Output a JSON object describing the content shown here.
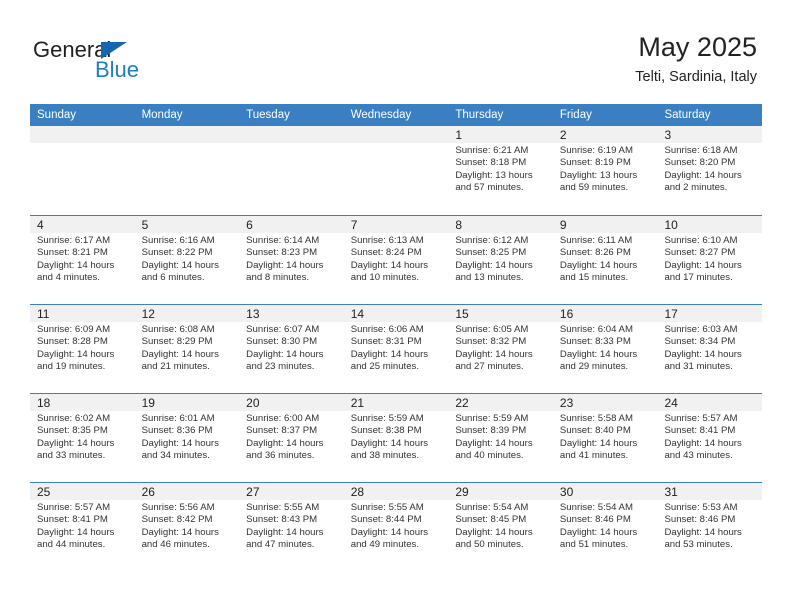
{
  "brand": {
    "name_primary": "General",
    "name_secondary": "Blue",
    "triangle_icon": "triangle-icon"
  },
  "header": {
    "title": "May 2025",
    "subtitle": "Telti, Sardinia, Italy"
  },
  "colors": {
    "header_blue": "#3a7fc1",
    "brand_blue": "#1f7dc4",
    "triangle_blue": "#1565b0",
    "daynum_bar": "#f1f1f1",
    "text": "#222222"
  },
  "weekdays": [
    "Sunday",
    "Monday",
    "Tuesday",
    "Wednesday",
    "Thursday",
    "Friday",
    "Saturday"
  ],
  "weeks": [
    [
      {
        "day": "",
        "empty": true
      },
      {
        "day": "",
        "empty": true
      },
      {
        "day": "",
        "empty": true
      },
      {
        "day": "",
        "empty": true
      },
      {
        "day": "1",
        "sunrise": "Sunrise: 6:21 AM",
        "sunset": "Sunset: 8:18 PM",
        "daylight": "Daylight: 13 hours and 57 minutes."
      },
      {
        "day": "2",
        "sunrise": "Sunrise: 6:19 AM",
        "sunset": "Sunset: 8:19 PM",
        "daylight": "Daylight: 13 hours and 59 minutes."
      },
      {
        "day": "3",
        "sunrise": "Sunrise: 6:18 AM",
        "sunset": "Sunset: 8:20 PM",
        "daylight": "Daylight: 14 hours and 2 minutes."
      }
    ],
    [
      {
        "day": "4",
        "sunrise": "Sunrise: 6:17 AM",
        "sunset": "Sunset: 8:21 PM",
        "daylight": "Daylight: 14 hours and 4 minutes."
      },
      {
        "day": "5",
        "sunrise": "Sunrise: 6:16 AM",
        "sunset": "Sunset: 8:22 PM",
        "daylight": "Daylight: 14 hours and 6 minutes."
      },
      {
        "day": "6",
        "sunrise": "Sunrise: 6:14 AM",
        "sunset": "Sunset: 8:23 PM",
        "daylight": "Daylight: 14 hours and 8 minutes."
      },
      {
        "day": "7",
        "sunrise": "Sunrise: 6:13 AM",
        "sunset": "Sunset: 8:24 PM",
        "daylight": "Daylight: 14 hours and 10 minutes."
      },
      {
        "day": "8",
        "sunrise": "Sunrise: 6:12 AM",
        "sunset": "Sunset: 8:25 PM",
        "daylight": "Daylight: 14 hours and 13 minutes."
      },
      {
        "day": "9",
        "sunrise": "Sunrise: 6:11 AM",
        "sunset": "Sunset: 8:26 PM",
        "daylight": "Daylight: 14 hours and 15 minutes."
      },
      {
        "day": "10",
        "sunrise": "Sunrise: 6:10 AM",
        "sunset": "Sunset: 8:27 PM",
        "daylight": "Daylight: 14 hours and 17 minutes."
      }
    ],
    [
      {
        "day": "11",
        "sunrise": "Sunrise: 6:09 AM",
        "sunset": "Sunset: 8:28 PM",
        "daylight": "Daylight: 14 hours and 19 minutes."
      },
      {
        "day": "12",
        "sunrise": "Sunrise: 6:08 AM",
        "sunset": "Sunset: 8:29 PM",
        "daylight": "Daylight: 14 hours and 21 minutes."
      },
      {
        "day": "13",
        "sunrise": "Sunrise: 6:07 AM",
        "sunset": "Sunset: 8:30 PM",
        "daylight": "Daylight: 14 hours and 23 minutes."
      },
      {
        "day": "14",
        "sunrise": "Sunrise: 6:06 AM",
        "sunset": "Sunset: 8:31 PM",
        "daylight": "Daylight: 14 hours and 25 minutes."
      },
      {
        "day": "15",
        "sunrise": "Sunrise: 6:05 AM",
        "sunset": "Sunset: 8:32 PM",
        "daylight": "Daylight: 14 hours and 27 minutes."
      },
      {
        "day": "16",
        "sunrise": "Sunrise: 6:04 AM",
        "sunset": "Sunset: 8:33 PM",
        "daylight": "Daylight: 14 hours and 29 minutes."
      },
      {
        "day": "17",
        "sunrise": "Sunrise: 6:03 AM",
        "sunset": "Sunset: 8:34 PM",
        "daylight": "Daylight: 14 hours and 31 minutes."
      }
    ],
    [
      {
        "day": "18",
        "sunrise": "Sunrise: 6:02 AM",
        "sunset": "Sunset: 8:35 PM",
        "daylight": "Daylight: 14 hours and 33 minutes."
      },
      {
        "day": "19",
        "sunrise": "Sunrise: 6:01 AM",
        "sunset": "Sunset: 8:36 PM",
        "daylight": "Daylight: 14 hours and 34 minutes."
      },
      {
        "day": "20",
        "sunrise": "Sunrise: 6:00 AM",
        "sunset": "Sunset: 8:37 PM",
        "daylight": "Daylight: 14 hours and 36 minutes."
      },
      {
        "day": "21",
        "sunrise": "Sunrise: 5:59 AM",
        "sunset": "Sunset: 8:38 PM",
        "daylight": "Daylight: 14 hours and 38 minutes."
      },
      {
        "day": "22",
        "sunrise": "Sunrise: 5:59 AM",
        "sunset": "Sunset: 8:39 PM",
        "daylight": "Daylight: 14 hours and 40 minutes."
      },
      {
        "day": "23",
        "sunrise": "Sunrise: 5:58 AM",
        "sunset": "Sunset: 8:40 PM",
        "daylight": "Daylight: 14 hours and 41 minutes."
      },
      {
        "day": "24",
        "sunrise": "Sunrise: 5:57 AM",
        "sunset": "Sunset: 8:41 PM",
        "daylight": "Daylight: 14 hours and 43 minutes."
      }
    ],
    [
      {
        "day": "25",
        "sunrise": "Sunrise: 5:57 AM",
        "sunset": "Sunset: 8:41 PM",
        "daylight": "Daylight: 14 hours and 44 minutes."
      },
      {
        "day": "26",
        "sunrise": "Sunrise: 5:56 AM",
        "sunset": "Sunset: 8:42 PM",
        "daylight": "Daylight: 14 hours and 46 minutes."
      },
      {
        "day": "27",
        "sunrise": "Sunrise: 5:55 AM",
        "sunset": "Sunset: 8:43 PM",
        "daylight": "Daylight: 14 hours and 47 minutes."
      },
      {
        "day": "28",
        "sunrise": "Sunrise: 5:55 AM",
        "sunset": "Sunset: 8:44 PM",
        "daylight": "Daylight: 14 hours and 49 minutes."
      },
      {
        "day": "29",
        "sunrise": "Sunrise: 5:54 AM",
        "sunset": "Sunset: 8:45 PM",
        "daylight": "Daylight: 14 hours and 50 minutes."
      },
      {
        "day": "30",
        "sunrise": "Sunrise: 5:54 AM",
        "sunset": "Sunset: 8:46 PM",
        "daylight": "Daylight: 14 hours and 51 minutes."
      },
      {
        "day": "31",
        "sunrise": "Sunrise: 5:53 AM",
        "sunset": "Sunset: 8:46 PM",
        "daylight": "Daylight: 14 hours and 53 minutes."
      }
    ]
  ]
}
